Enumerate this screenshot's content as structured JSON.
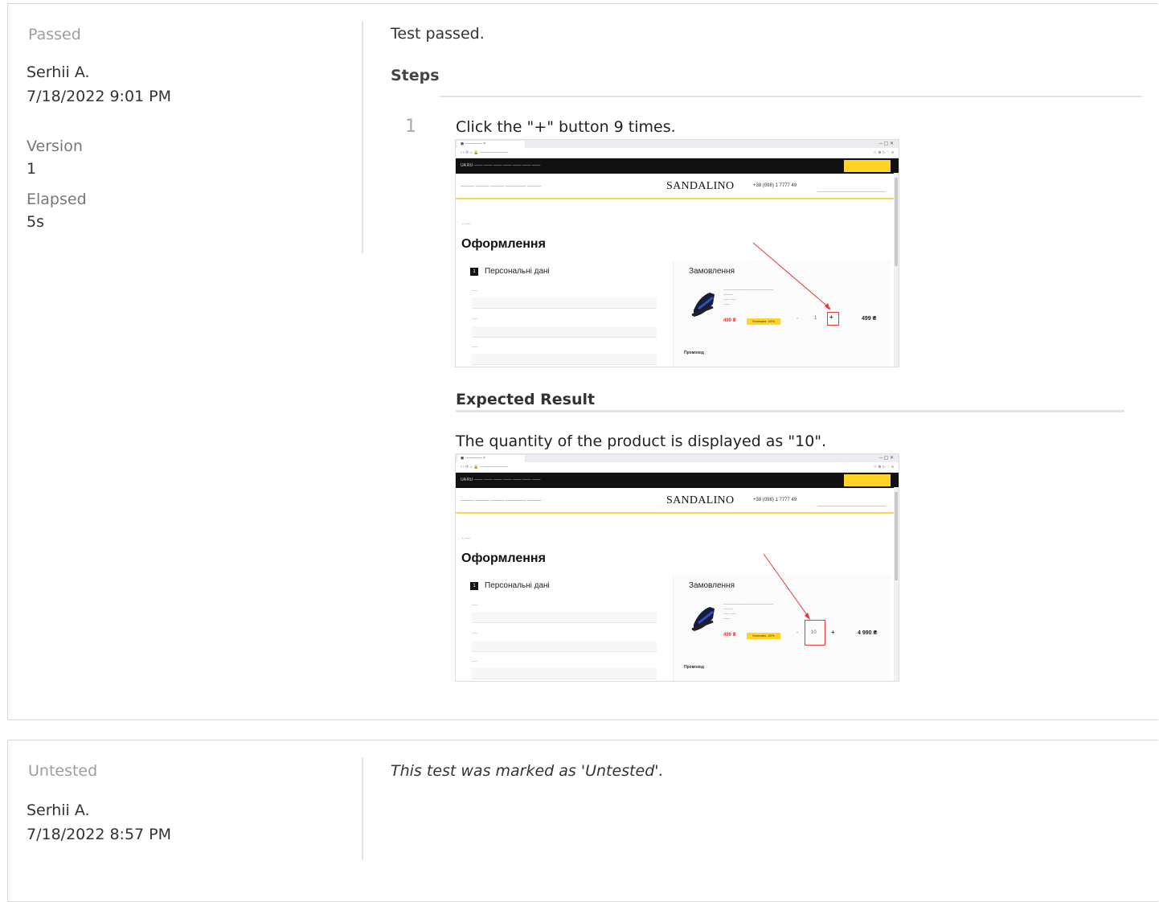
{
  "result1": {
    "status": "Passed",
    "user": "Serhii A.",
    "datetime": "7/18/2022 9:01 PM",
    "version_label": "Version",
    "version_value": "1",
    "elapsed_label": "Elapsed",
    "elapsed_value": "5s",
    "comment": "Test passed.",
    "steps_heading": "Steps",
    "step_number": "1",
    "step_text": "Click the \"+\" button 9 times.",
    "expected_heading": "Expected Result",
    "expected_text": "The quantity of the product is displayed as \"10\"."
  },
  "shot1": {
    "logo": "SANDALINO",
    "phone": "+38 (098) 1 7777 49",
    "heading": "Оформлення",
    "section_personal": "Персональні дані",
    "section_order": "Замовлення",
    "promo": "Промокод",
    "price": "499 ₴",
    "discount": "Економія -33%",
    "qty": "1",
    "plus": "+",
    "minus": "-",
    "total": "499 ₴"
  },
  "shot2": {
    "logo": "SANDALINO",
    "phone": "+38 (098) 1 7777 49",
    "heading": "Оформлення",
    "section_personal": "Персональні дані",
    "section_order": "Замовлення",
    "promo": "Промокод",
    "price": "499 ₴",
    "discount": "Економія -33%",
    "qty": "10",
    "plus": "+",
    "minus": "-",
    "total": "4 990 ₴"
  },
  "result2": {
    "status": "Untested",
    "user": "Serhii A.",
    "datetime": "7/18/2022 8:57 PM",
    "comment": "This test was marked as 'Untested'."
  }
}
